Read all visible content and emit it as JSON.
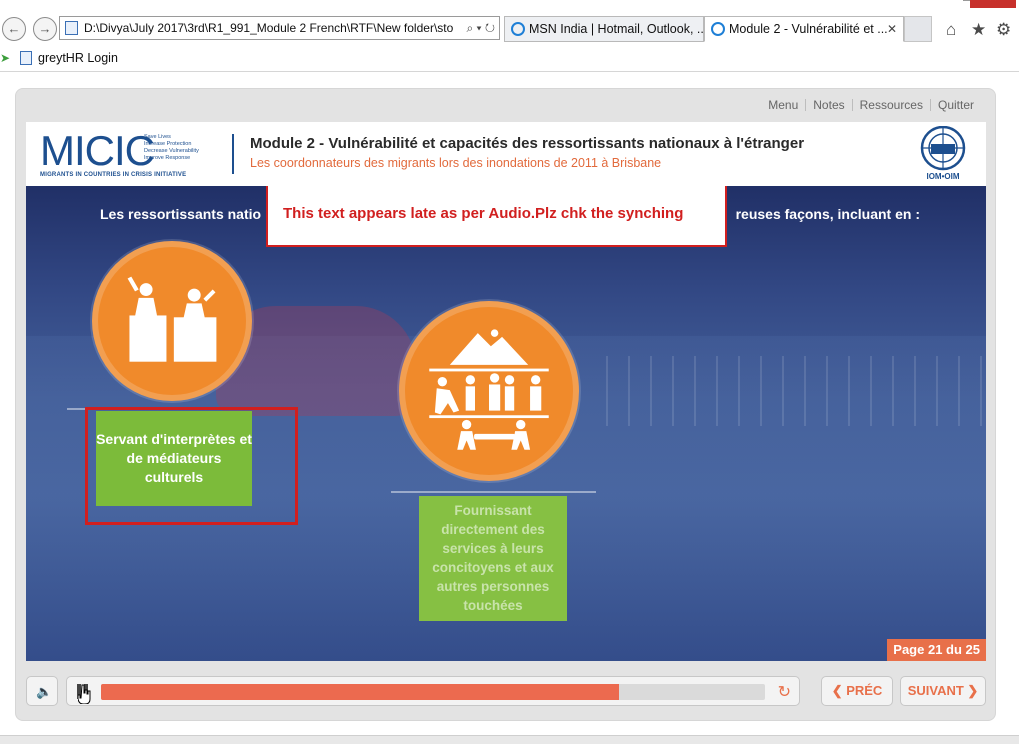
{
  "browser": {
    "address": "D:\\Divya\\July 2017\\3rd\\R1_991_Module 2 French\\RTF\\New folder\\sto",
    "address_tools": "⌕ ▾ ↻",
    "tabs": [
      {
        "label": "MSN India | Hotmail, Outlook, ..."
      },
      {
        "label": "Module 2 - Vulnérabilité et ...",
        "active": true,
        "close": "✕"
      }
    ],
    "favorites": [
      {
        "label": "greytHR Login"
      }
    ],
    "window_controls": {
      "minimize": "–",
      "maximize": "□",
      "close": "✕"
    }
  },
  "player": {
    "top_menu": [
      "Menu",
      "Notes",
      "Ressources",
      "Quitter"
    ],
    "logo": {
      "word": "MICIC",
      "tagline": [
        "Save Lives",
        "Increase Protection",
        "Decrease Vulnerability",
        "Improve Response"
      ],
      "subline": "MIGRANTS IN COUNTRIES IN CRISIS INITIATIVE"
    },
    "title": "Module 2 - Vulnérabilité et capacités des ressortissants nationaux à l'étranger",
    "subtitle": "Les coordonnateurs des migrants lors des inondations de 2011 à Brisbane",
    "iom_label": "IOM•OIM",
    "slide": {
      "intro_left": "Les ressortissants natio",
      "intro_right": "reuses façons, incluant en :",
      "review_note": "This text appears late as per Audio.Plz chk the synching",
      "items": [
        {
          "label": "Servant d'interprètes et de médiateurs culturels",
          "icon": "podium-speakers-icon"
        },
        {
          "label": "Fournissant directement des services à leurs concitoyens et aux autres personnes touchées",
          "icon": "rescue-team-icon"
        }
      ],
      "page_indicator": "Page 21 du 25"
    },
    "controls": {
      "progress": 0.78,
      "prev_label": "❮ PRÉC",
      "next_label": "SUIVANT ❯",
      "accent": "#e8704a"
    }
  }
}
